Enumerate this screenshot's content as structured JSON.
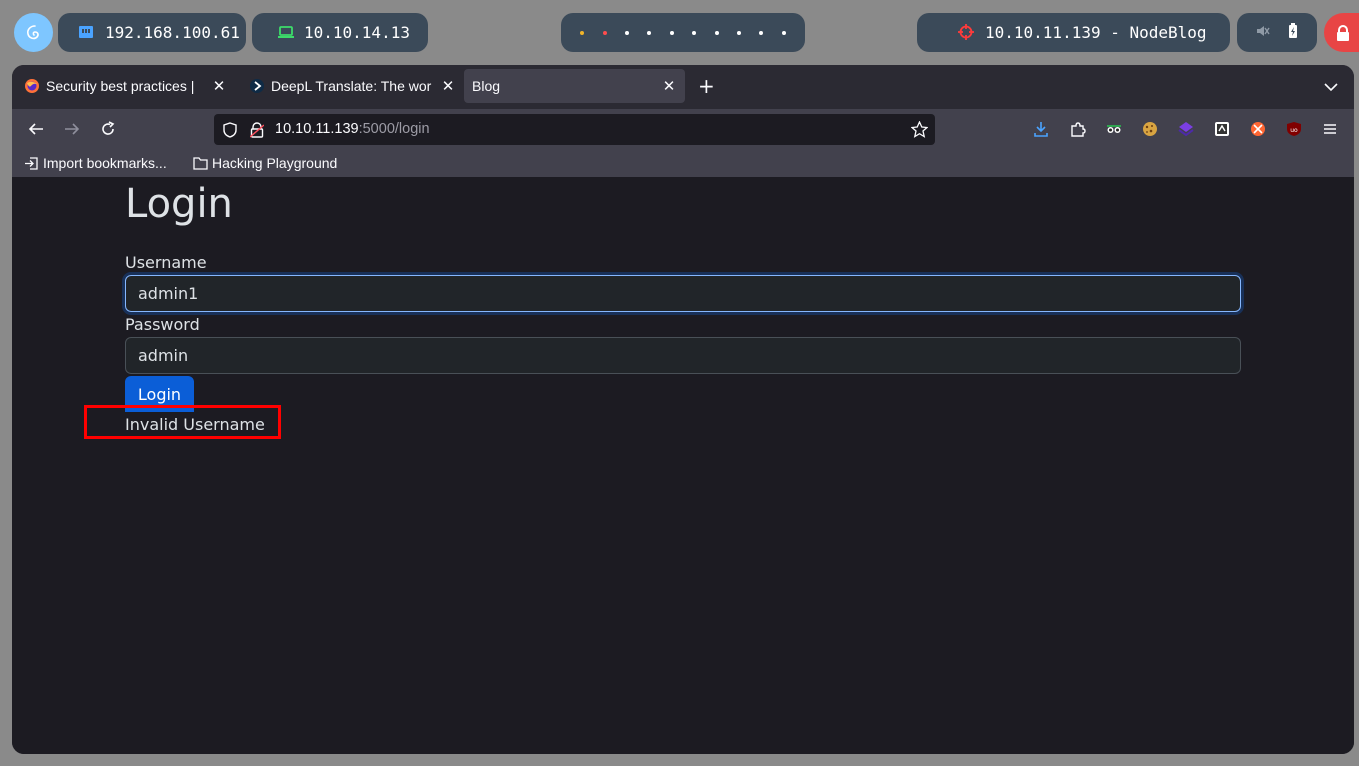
{
  "desktop_bar": {
    "local_ip": "192.168.100.61",
    "vpn_ip": "10.10.14.13",
    "target": "10.10.11.139 - NodeBlog",
    "colors": {
      "pill": "#3b4a59",
      "lock": "#e84545",
      "launcher": "#7ec6ff"
    }
  },
  "browser": {
    "tabs": [
      {
        "title": "Security best practices |",
        "icon": "firefox-icon"
      },
      {
        "title": "DeepL Translate: The wor",
        "icon": "deepl-icon"
      },
      {
        "title": "Blog",
        "icon": "none",
        "active": true
      }
    ],
    "url": {
      "host": "10.10.11.139",
      "path": ":5000/login"
    },
    "bookmarks": [
      {
        "label": "Import bookmarks...",
        "icon": "import-icon"
      },
      {
        "label": "Hacking Playground",
        "icon": "folder-icon"
      }
    ],
    "extensions": [
      "download-icon",
      "extensions-puzzle-icon",
      "foxyproxy-icon",
      "cookie-editor-icon",
      "wappalyzer-icon",
      "hacktools-icon",
      "burp-icon",
      "ublock-origin-icon",
      "menu-icon"
    ]
  },
  "page": {
    "title": "Login",
    "username_label": "Username",
    "username_value": "admin1",
    "password_label": "Password",
    "password_value": "admin",
    "login_button": "Login",
    "error_message": "Invalid Username"
  }
}
